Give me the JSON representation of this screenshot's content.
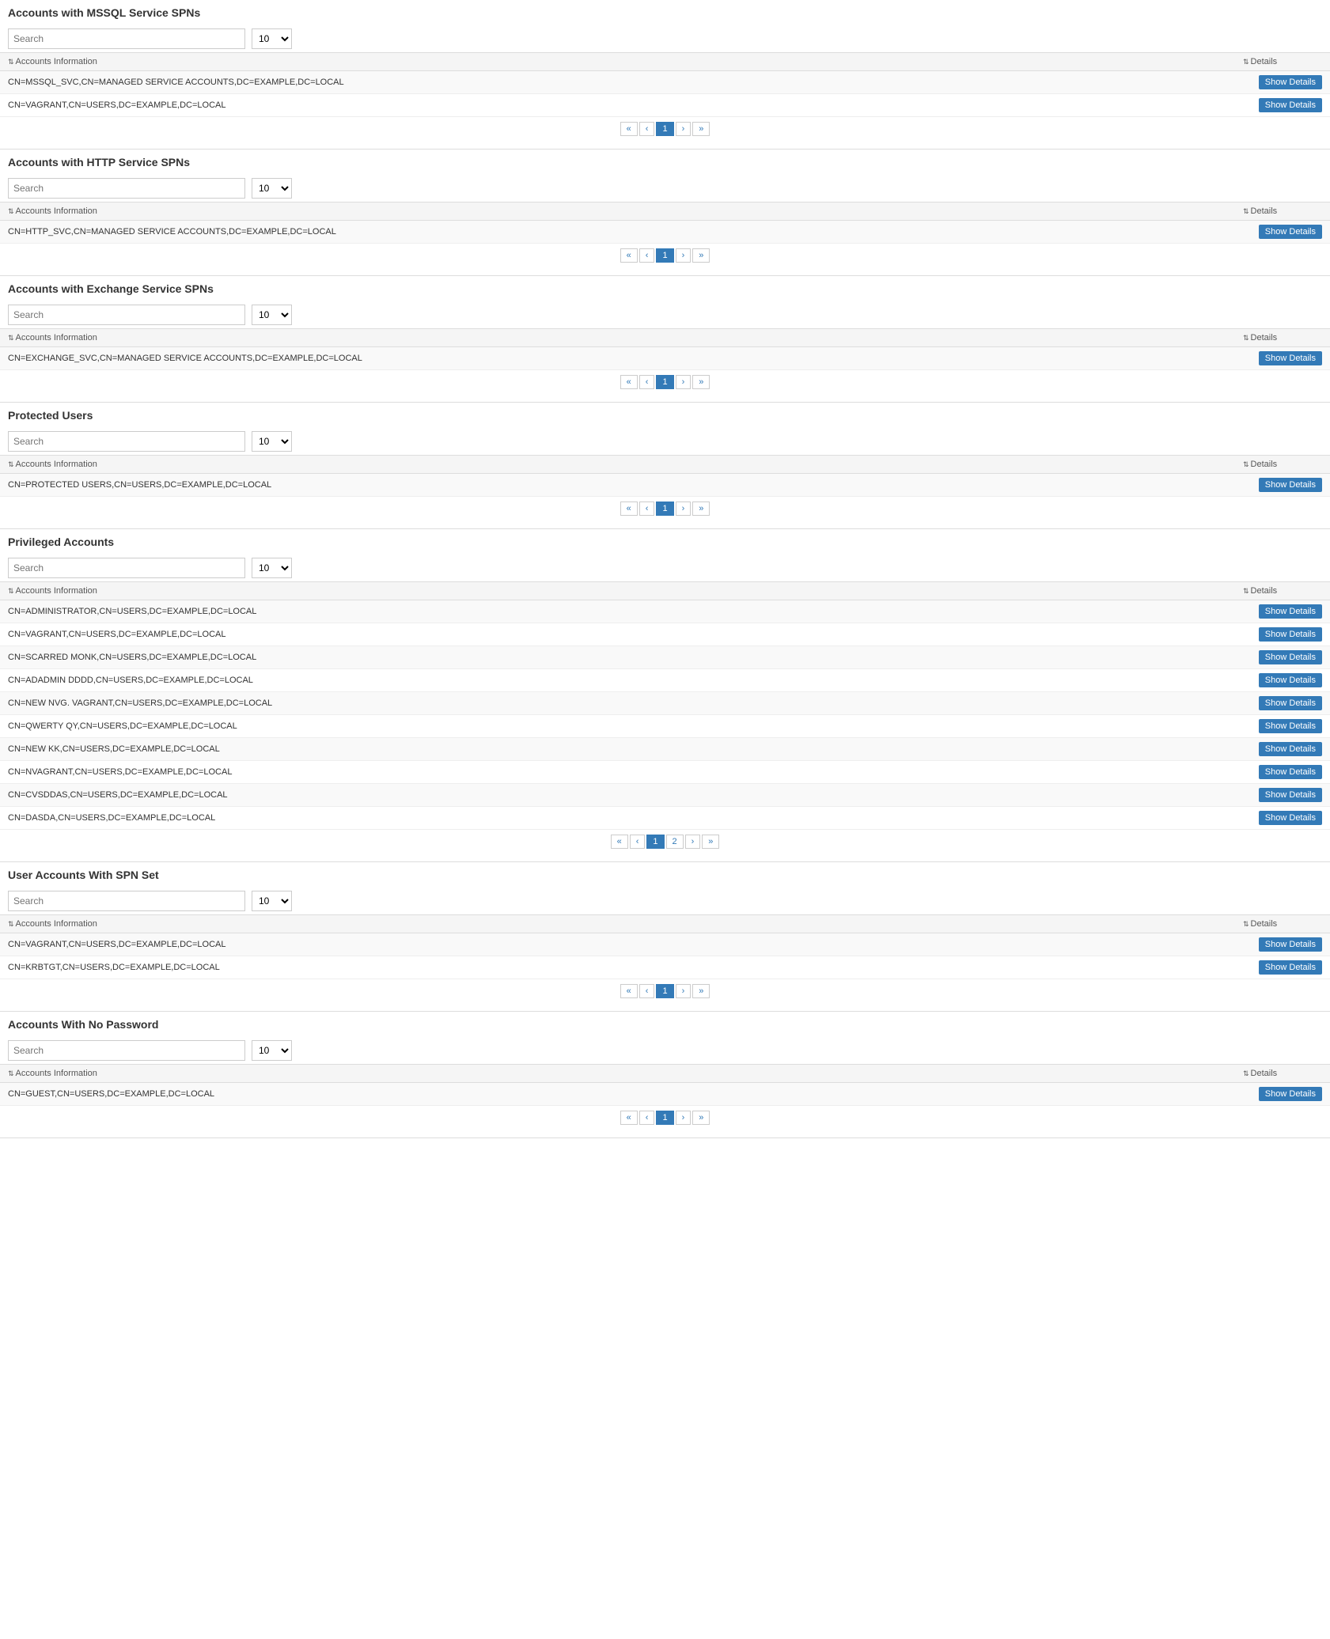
{
  "sections": [
    {
      "id": "mssql-spns",
      "title": "Accounts with MSSQL Service SPNs",
      "search_placeholder": "Search",
      "page_size": "10",
      "col_accounts": "Accounts Information",
      "col_details": "Details",
      "rows": [
        {
          "account": "CN=MSSQL_SVC,CN=MANAGED SERVICE ACCOUNTS,DC=EXAMPLE,DC=LOCAL",
          "btn": "Show Details"
        },
        {
          "account": "CN=VAGRANT,CN=USERS,DC=EXAMPLE,DC=LOCAL",
          "btn": "Show Details"
        }
      ],
      "pagination": {
        "prev_prev": "«",
        "prev": "‹",
        "current": "1",
        "next": "›",
        "next_next": "»"
      }
    },
    {
      "id": "http-spns",
      "title": "Accounts with HTTP Service SPNs",
      "search_placeholder": "Search",
      "page_size": "10",
      "col_accounts": "Accounts Information",
      "col_details": "Details",
      "rows": [
        {
          "account": "CN=HTTP_SVC,CN=MANAGED SERVICE ACCOUNTS,DC=EXAMPLE,DC=LOCAL",
          "btn": "Show Details"
        }
      ],
      "pagination": {
        "prev_prev": "«",
        "prev": "‹",
        "current": "1",
        "next": "›",
        "next_next": "»"
      }
    },
    {
      "id": "exchange-spns",
      "title": "Accounts with Exchange Service SPNs",
      "search_placeholder": "Search",
      "page_size": "10",
      "col_accounts": "Accounts Information",
      "col_details": "Details",
      "rows": [
        {
          "account": "CN=EXCHANGE_SVC,CN=MANAGED SERVICE ACCOUNTS,DC=EXAMPLE,DC=LOCAL",
          "btn": "Show Details"
        }
      ],
      "pagination": {
        "prev_prev": "«",
        "prev": "‹",
        "current": "1",
        "next": "›",
        "next_next": "»"
      }
    },
    {
      "id": "protected-users",
      "title": "Protected Users",
      "search_placeholder": "Search",
      "page_size": "10",
      "col_accounts": "Accounts Information",
      "col_details": "Details",
      "rows": [
        {
          "account": "CN=PROTECTED USERS,CN=USERS,DC=EXAMPLE,DC=LOCAL",
          "btn": "Show Details"
        }
      ],
      "pagination": {
        "prev_prev": "«",
        "prev": "‹",
        "current": "1",
        "next": "›",
        "next_next": "»"
      }
    },
    {
      "id": "privileged-accounts",
      "title": "Privileged Accounts",
      "search_placeholder": "Search",
      "page_size": "10",
      "col_accounts": "Accounts Information",
      "col_details": "Details",
      "rows": [
        {
          "account": "CN=ADMINISTRATOR,CN=USERS,DC=EXAMPLE,DC=LOCAL",
          "btn": "Show Details"
        },
        {
          "account": "CN=VAGRANT,CN=USERS,DC=EXAMPLE,DC=LOCAL",
          "btn": "Show Details"
        },
        {
          "account": "CN=SCARRED MONK,CN=USERS,DC=EXAMPLE,DC=LOCAL",
          "btn": "Show Details"
        },
        {
          "account": "CN=ADADMIN DDDD,CN=USERS,DC=EXAMPLE,DC=LOCAL",
          "btn": "Show Details"
        },
        {
          "account": "CN=NEW NVG. VAGRANT,CN=USERS,DC=EXAMPLE,DC=LOCAL",
          "btn": "Show Details"
        },
        {
          "account": "CN=QWERTY QY,CN=USERS,DC=EXAMPLE,DC=LOCAL",
          "btn": "Show Details"
        },
        {
          "account": "CN=NEW KK,CN=USERS,DC=EXAMPLE,DC=LOCAL",
          "btn": "Show Details"
        },
        {
          "account": "CN=NVAGRANT,CN=USERS,DC=EXAMPLE,DC=LOCAL",
          "btn": "Show Details"
        },
        {
          "account": "CN=CVSDDAS,CN=USERS,DC=EXAMPLE,DC=LOCAL",
          "btn": "Show Details"
        },
        {
          "account": "CN=DASDA,CN=USERS,DC=EXAMPLE,DC=LOCAL",
          "btn": "Show Details"
        }
      ],
      "pagination": {
        "prev_prev": "«",
        "prev": "‹",
        "current": "1",
        "page2": "2",
        "next": "›",
        "next_next": "»"
      },
      "has_page2": true
    },
    {
      "id": "user-accounts-spn",
      "title": "User Accounts With SPN Set",
      "search_placeholder": "Search",
      "page_size": "10",
      "col_accounts": "Accounts Information",
      "col_details": "Details",
      "rows": [
        {
          "account": "CN=VAGRANT,CN=USERS,DC=EXAMPLE,DC=LOCAL",
          "btn": "Show Details"
        },
        {
          "account": "CN=KRBTGT,CN=USERS,DC=EXAMPLE,DC=LOCAL",
          "btn": "Show Details"
        }
      ],
      "pagination": {
        "prev_prev": "«",
        "prev": "‹",
        "current": "1",
        "next": "›",
        "next_next": "»"
      }
    },
    {
      "id": "no-password",
      "title": "Accounts With No Password",
      "search_placeholder": "Search",
      "page_size": "10",
      "col_accounts": "Accounts Information",
      "col_details": "Details",
      "rows": [
        {
          "account": "CN=GUEST,CN=USERS,DC=EXAMPLE,DC=LOCAL",
          "btn": "Show Details"
        }
      ],
      "pagination": {
        "prev_prev": "«",
        "prev": "‹",
        "current": "1",
        "next": "›",
        "next_next": "»"
      }
    }
  ],
  "labels": {
    "sort_icon": "⇅",
    "show_details": "Show Details"
  }
}
